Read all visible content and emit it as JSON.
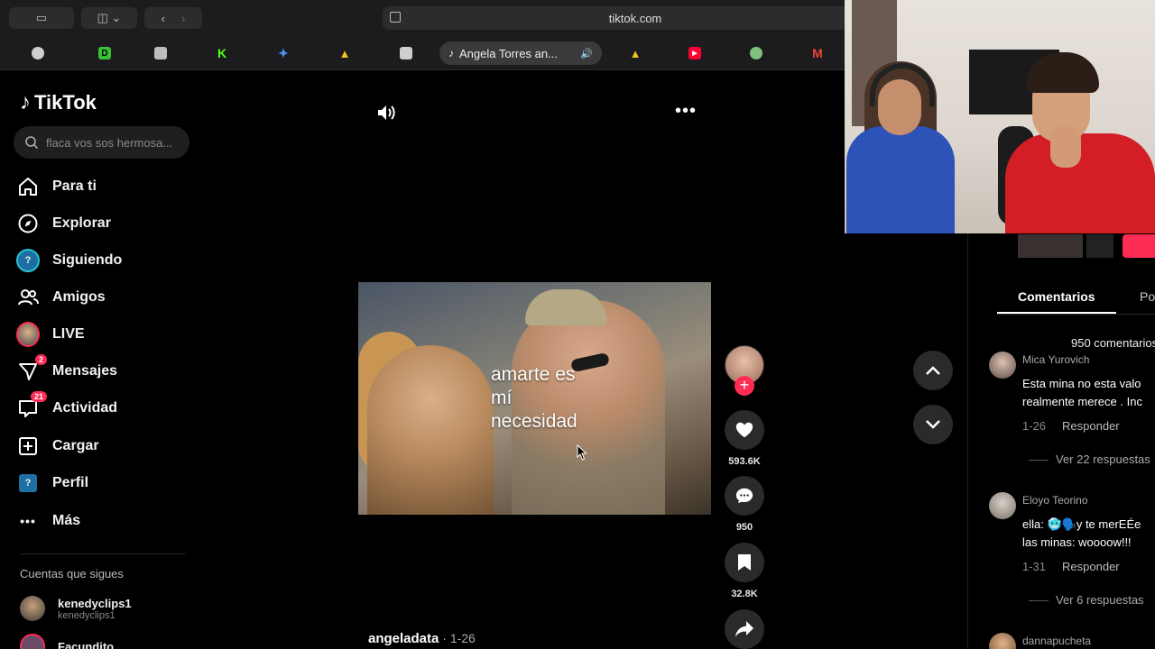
{
  "browser": {
    "url": "tiktok.com",
    "active_tab": {
      "title": "Angela Torres an..."
    },
    "tabs": [
      {
        "icon": "openai-icon",
        "color": "#cfcfcf"
      },
      {
        "icon": "d-app-icon",
        "color": "#37c337",
        "letter": "D"
      },
      {
        "icon": "notion-like-icon",
        "color": "#bdbdbd"
      },
      {
        "icon": "kick-icon",
        "color": "#53fc18",
        "letter": "K"
      },
      {
        "icon": "gemini-icon",
        "color": "#4f8df7"
      },
      {
        "icon": "google-drive-icon",
        "color": "#f6c026"
      },
      {
        "icon": "sheets-icon",
        "color": "#cfcfcf"
      },
      {
        "icon": "google-drive-icon",
        "color": "#f6c026"
      },
      {
        "icon": "youtube-icon",
        "color": "#ff0033"
      },
      {
        "icon": "game-icon",
        "color": "#7fbf7f"
      },
      {
        "icon": "gmail-icon",
        "color": "#ea4335",
        "letter": "M"
      }
    ]
  },
  "sidebar": {
    "logo": "TikTok",
    "search_placeholder": "flaca vos sos hermosa...",
    "nav": [
      {
        "label": "Para ti",
        "icon": "home-icon"
      },
      {
        "label": "Explorar",
        "icon": "compass-icon"
      },
      {
        "label": "Siguiendo",
        "icon": "following-avatar-icon"
      },
      {
        "label": "Amigos",
        "icon": "friends-icon"
      },
      {
        "label": "LIVE",
        "icon": "live-avatar-icon"
      },
      {
        "label": "Mensajes",
        "icon": "messages-icon",
        "badge": "2"
      },
      {
        "label": "Actividad",
        "icon": "activity-icon",
        "badge": "21"
      },
      {
        "label": "Cargar",
        "icon": "upload-icon"
      },
      {
        "label": "Perfil",
        "icon": "profile-avatar-icon"
      },
      {
        "label": "Más",
        "icon": "more-dots-icon"
      }
    ],
    "following_title": "Cuentas que sigues",
    "following": [
      {
        "name": "kenedyclips1",
        "handle": "kenedyclips1"
      },
      {
        "name": "Facundito",
        "handle": ""
      }
    ]
  },
  "video": {
    "lyrics": "amarte  es\nmí\nnecesidad",
    "author": "angeladata",
    "date": " · 1-26",
    "likes": "593.6K",
    "comments": "950",
    "saves": "32.8K"
  },
  "comments_panel": {
    "tab_comments": "Comentarios",
    "tab_other": "Po",
    "count": "950 comentarios",
    "items": [
      {
        "user": "Mica Yurovich",
        "text": "Esta mina no esta valo\nrealmente merece . Inc",
        "date": "1-26",
        "reply": "Responder",
        "replies": "Ver 22 respuestas"
      },
      {
        "user": "Eloyo Teorino",
        "text": "ella: 🥶🗣️y te merEÉe\nlas minas: woooow!!!",
        "date": "1-31",
        "reply": "Responder",
        "replies": "Ver 6 respuestas"
      },
      {
        "user": "dannapucheta",
        "text": "",
        "date": "",
        "reply": "",
        "replies": ""
      }
    ]
  }
}
